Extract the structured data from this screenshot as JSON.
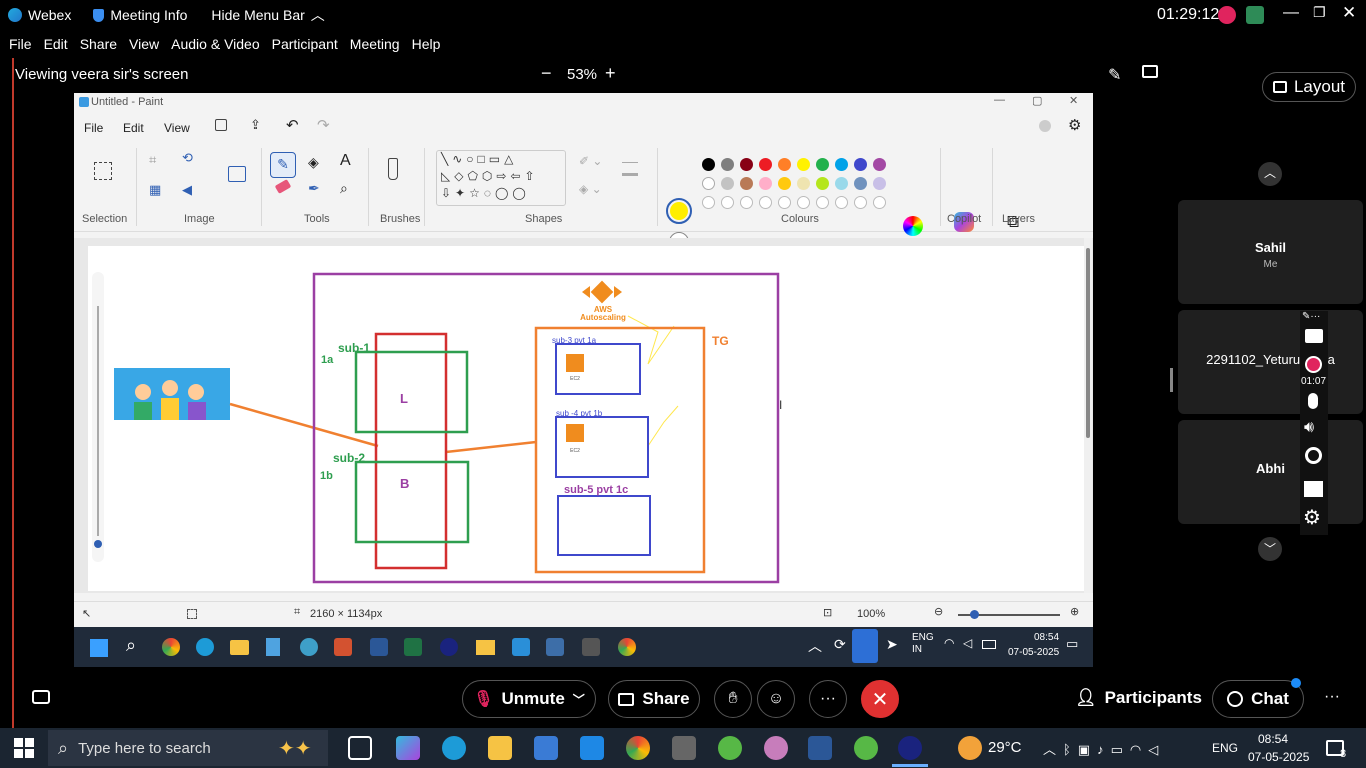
{
  "webex": {
    "app_name": "Webex",
    "meeting_info": "Meeting Info",
    "hide_menu_bar": "Hide Menu Bar",
    "clock": "01:29:12",
    "menu": [
      "File",
      "Edit",
      "Share",
      "View",
      "Audio & Video",
      "Participant",
      "Meeting",
      "Help"
    ],
    "viewing_label": "Viewing veera sir's screen",
    "zoom": "53%",
    "layout_label": "Layout"
  },
  "paint": {
    "title": "Untitled - Paint",
    "menu": [
      "File",
      "Edit",
      "View"
    ],
    "groups": [
      "Selection",
      "Image",
      "Tools",
      "Brushes",
      "Shapes",
      "Colours",
      "Copilot",
      "Layers"
    ],
    "colors_row1": [
      "#000000",
      "#7f7f7f",
      "#880015",
      "#ed1c24",
      "#ff7f27",
      "#fff200",
      "#22b14c",
      "#00a2e8",
      "#3f48cc",
      "#a349a4"
    ],
    "colors_row2": [
      "#ffffff",
      "#c3c3c3",
      "#b97a57",
      "#ffaec9",
      "#ffc90e",
      "#efe4b0",
      "#b5e61d",
      "#99d9ea",
      "#7092be",
      "#c8bfe7"
    ],
    "primary_color": "#ffee00",
    "canvas_size": "2160 × 1134px",
    "zoom": "100%",
    "diagram": {
      "aws_label": "AWS\nAutoscaling",
      "sub1": "sub-1",
      "sub2": "sub-2",
      "az1": "1a",
      "az2": "1b",
      "L": "L",
      "B": "B",
      "tg": "TG",
      "sub3": "sub-3 pvt 1a",
      "sub4": "sub -4 pvt 1b",
      "sub5": "sub-5 pvt 1c",
      "ec2": "EC2"
    },
    "inner_clock": "08:54",
    "inner_date": "07-05-2025",
    "inner_lang": "ENG\nIN"
  },
  "participants": [
    {
      "name": "Sahil",
      "sub": "Me"
    },
    {
      "name": "2291102_Yeturu R... a",
      "sub": ""
    },
    {
      "name": "Abhi",
      "sub": ""
    }
  ],
  "recording_time": "01:07",
  "controls": {
    "unmute": "Unmute",
    "share": "Share",
    "participants": "Participants",
    "chat": "Chat"
  },
  "windows": {
    "search_placeholder": "Type here to search",
    "weather": "29°C",
    "lang": "ENG",
    "time": "08:54",
    "date": "07-05-2025",
    "notif_count": "8"
  }
}
